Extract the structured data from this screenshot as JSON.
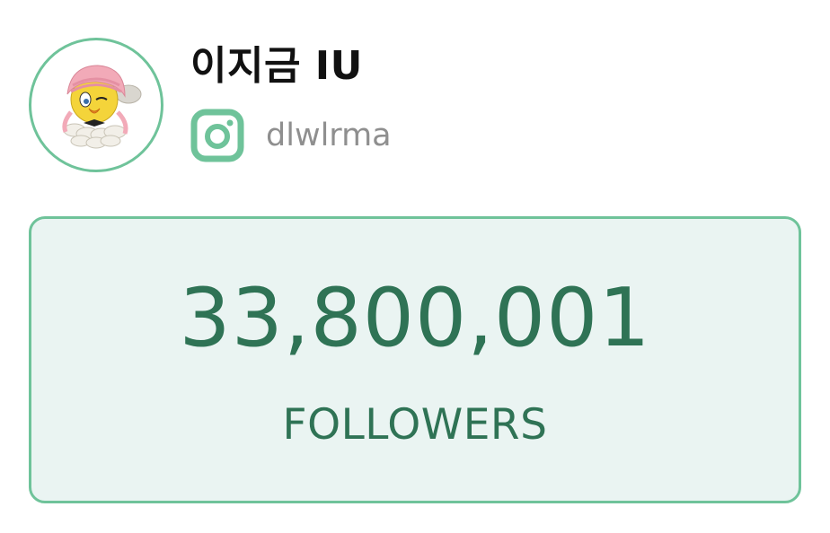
{
  "profile": {
    "display_name": "이지금 IU",
    "handle": "dlwlrma",
    "platform_icon": "instagram-icon",
    "avatar_icon": "cartoon-bird-avatar"
  },
  "stats": {
    "followers_count": "33,800,001",
    "followers_label": "FOLLOWERS"
  },
  "colors": {
    "accent": "#6fc39a",
    "count_text": "#2f7355",
    "card_background": "#eaf4f2",
    "handle_text": "#8f8f8f",
    "name_text": "#111111"
  }
}
